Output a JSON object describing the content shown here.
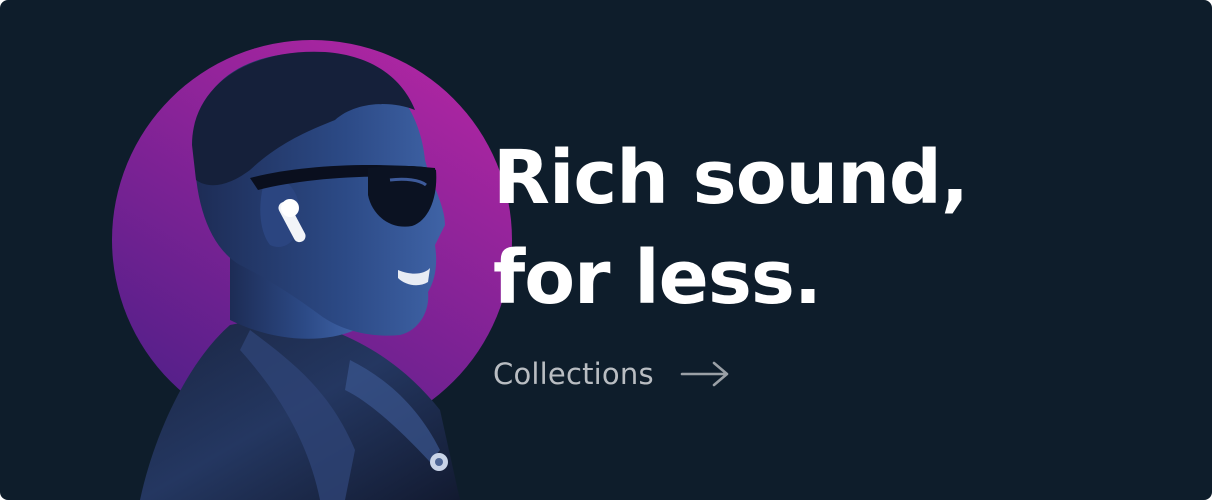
{
  "banner": {
    "headline_line1": "Rich sound,",
    "headline_line2": "for less.",
    "cta_label": "Collections",
    "cta_icon": "arrow-right-icon",
    "background_color": "#0e1d2b",
    "accent_gradient": [
      "#b126a3",
      "#5a1f8c"
    ],
    "hero_image": "man-with-wireless-earbuds-photo"
  }
}
